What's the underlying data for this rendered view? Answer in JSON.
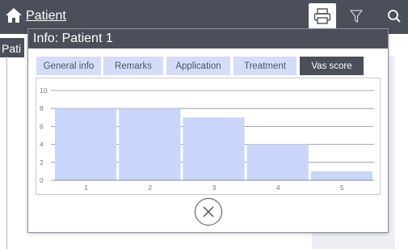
{
  "topbar": {
    "title": "Patient",
    "icons": [
      "home-icon",
      "printer-icon",
      "filter-icon",
      "search-icon"
    ]
  },
  "side": {
    "label": "Pati"
  },
  "dialog": {
    "title": "Info: Patient 1",
    "tabs": [
      {
        "label": "General info",
        "active": false
      },
      {
        "label": "Remarks",
        "active": false
      },
      {
        "label": "Application",
        "active": false
      },
      {
        "label": "Treatment",
        "active": false
      },
      {
        "label": "Vas score",
        "active": true
      }
    ],
    "close_icon": "close-circle-icon"
  },
  "colors": {
    "header": "#4a4f5a",
    "tab_inactive": "#d5dcf7",
    "bar": "#c9d5fa",
    "panel": "#edeff5"
  },
  "chart_data": {
    "type": "bar",
    "categories": [
      "1",
      "2",
      "3",
      "4",
      "5"
    ],
    "values": [
      8,
      8,
      7,
      4,
      1
    ],
    "yticks": [
      "0",
      "2",
      "4",
      "6",
      "8",
      "10"
    ],
    "ylim": [
      0,
      10
    ],
    "grid": true,
    "title": "",
    "xlabel": "",
    "ylabel": ""
  }
}
